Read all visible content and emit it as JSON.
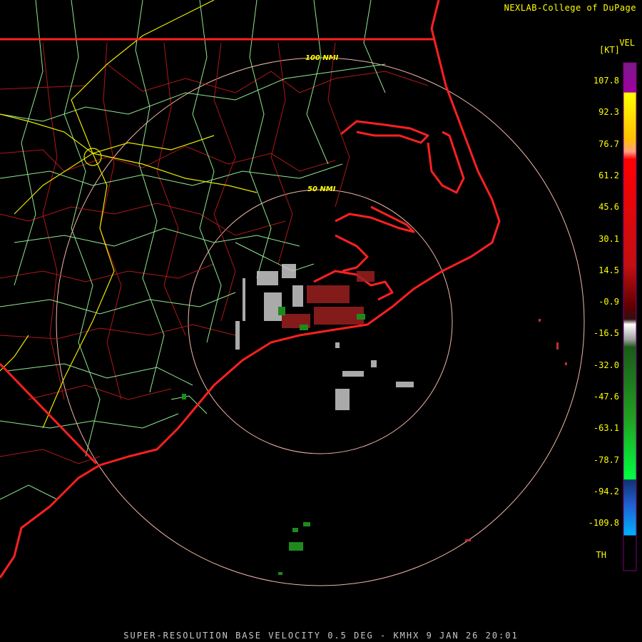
{
  "header": {
    "credit": "NEXLAB-College of DuPage"
  },
  "footer": {
    "caption": "SUPER-RESOLUTION BASE VELOCITY 0.5 DEG - KMHX 9 JAN 26 20:01"
  },
  "legend": {
    "product": "VEL",
    "unit": "[KT]",
    "ticks": [
      "107.8",
      "92.3",
      "76.7",
      "61.2",
      "45.6",
      "30.1",
      "14.5",
      "-0.9",
      "-16.5",
      "-32.0",
      "-47.6",
      "-63.1",
      "-78.7",
      "-94.2",
      "-109.8",
      "TH"
    ]
  },
  "range_rings": [
    {
      "label": "100 NMI"
    },
    {
      "label": "50 NMI"
    }
  ],
  "colors": {
    "coast": "#ff2020",
    "county": "#b01818",
    "roads": "#90e890",
    "interstate": "#e8e800",
    "ring": "#f0b8a8"
  }
}
